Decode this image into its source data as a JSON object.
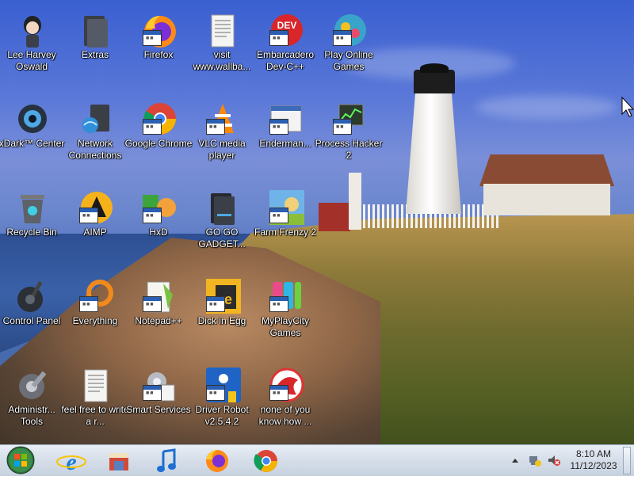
{
  "desktop": {
    "icons": [
      {
        "label": "Lee Harvey Oswald",
        "icon": "person-icon"
      },
      {
        "label": "Extras",
        "icon": "folder-icon"
      },
      {
        "label": "Firefox",
        "icon": "firefox-icon"
      },
      {
        "label": "visit www.wallba...",
        "icon": "document-icon"
      },
      {
        "label": "Embarcadero Dev-C++",
        "icon": "devcpp-icon"
      },
      {
        "label": "Play Online Games",
        "icon": "games-icon"
      },
      {
        "label": "xDark™ Center",
        "icon": "xdark-icon"
      },
      {
        "label": "Network Connections",
        "icon": "network-icon"
      },
      {
        "label": "Google Chrome",
        "icon": "chrome-icon"
      },
      {
        "label": "VLC media player",
        "icon": "vlc-icon"
      },
      {
        "label": "Enderman...",
        "icon": "window-icon"
      },
      {
        "label": "Process Hacker 2",
        "icon": "process-hacker-icon"
      },
      {
        "label": "Recycle Bin",
        "icon": "recycle-bin-icon"
      },
      {
        "label": "AIMP",
        "icon": "aimp-icon"
      },
      {
        "label": "HxD",
        "icon": "hxd-icon"
      },
      {
        "label": "GO GO GADGET...",
        "icon": "folder-icon"
      },
      {
        "label": "Farm Frenzy 2",
        "icon": "farm-frenzy-icon"
      },
      {
        "label": "Control Panel",
        "icon": "control-panel-icon"
      },
      {
        "label": "Everything",
        "icon": "everything-icon"
      },
      {
        "label": "Notepad++",
        "icon": "notepadpp-icon"
      },
      {
        "label": "Dick in Egg",
        "icon": "game-icon"
      },
      {
        "label": "MyPlayCity Games",
        "icon": "myplaycity-icon"
      },
      {
        "label": "Administr... Tools",
        "icon": "admin-tools-icon"
      },
      {
        "label": "feel free to write a r...",
        "icon": "document-icon"
      },
      {
        "label": "Smart Services",
        "icon": "services-icon"
      },
      {
        "label": "Driver Robot v2.5.4.2",
        "icon": "driver-robot-icon"
      },
      {
        "label": "none of you know how ...",
        "icon": "red-app-icon"
      }
    ]
  },
  "taskbar": {
    "start": "windows-start-orb",
    "pinned": [
      "internet-explorer-icon",
      "store-icon",
      "music-icon",
      "firefox-icon",
      "chrome-icon"
    ],
    "tray": [
      "show-hidden-icons-arrow",
      "network-tray-icon",
      "volume-muted-icon"
    ],
    "clock": {
      "time": "8:10 AM",
      "date": "11/12/2023"
    }
  },
  "colors": {
    "taskbar": "#d7dfea",
    "sky": "#5a78d8"
  }
}
